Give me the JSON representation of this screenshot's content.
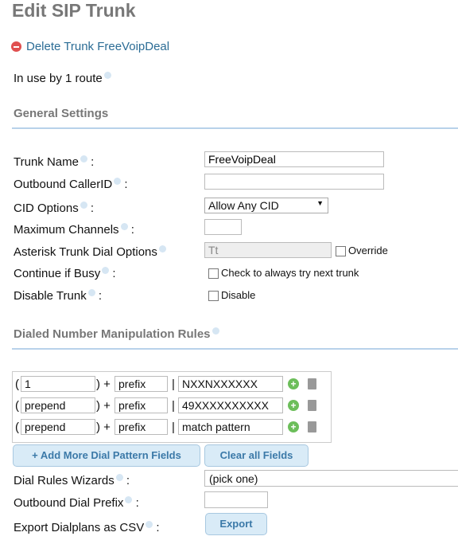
{
  "title": "Edit SIP Trunk",
  "delete_link": "Delete Trunk FreeVoipDeal",
  "in_use": "In use by 1 route",
  "general": {
    "heading": "General Settings",
    "trunk_name_label": "Trunk Name",
    "trunk_name": "FreeVoipDeal",
    "callerid_label": "Outbound CallerID",
    "callerid": "",
    "cid_label": "CID Options",
    "cid_value": "Allow Any CID",
    "channels_label": "Maximum Channels",
    "channels": "",
    "dial_opts_label": "Asterisk Trunk Dial Options",
    "dial_opts": "Tt",
    "override": "Override",
    "busy_label": "Continue if Busy",
    "busy_text": "Check to always try next trunk",
    "disable_label": "Disable Trunk",
    "disable_text": "Disable"
  },
  "rules": {
    "heading": "Dialed Number Manipulation Rules",
    "rows": [
      {
        "prepend": "1",
        "prefix": "prefix",
        "pattern": "NXXNXXXXXX"
      },
      {
        "prepend": "prepend",
        "prefix": "prefix",
        "pattern": "49XXXXXXXXXX"
      },
      {
        "prepend": "prepend",
        "prefix": "prefix",
        "pattern": "match pattern"
      }
    ],
    "add_button": "+ Add More Dial Pattern Fields",
    "clear_button": "Clear all Fields",
    "wizards_label": "Dial Rules Wizards",
    "wizards_value": "(pick one)",
    "prefix_label": "Outbound Dial Prefix",
    "prefix_value": "",
    "export_label": "Export Dialplans as CSV",
    "export_button": "Export"
  },
  "colors": {
    "link": "#2b6c95",
    "heading": "#777777",
    "rule": "#b8d2ea",
    "button": "#d9ebf7"
  }
}
